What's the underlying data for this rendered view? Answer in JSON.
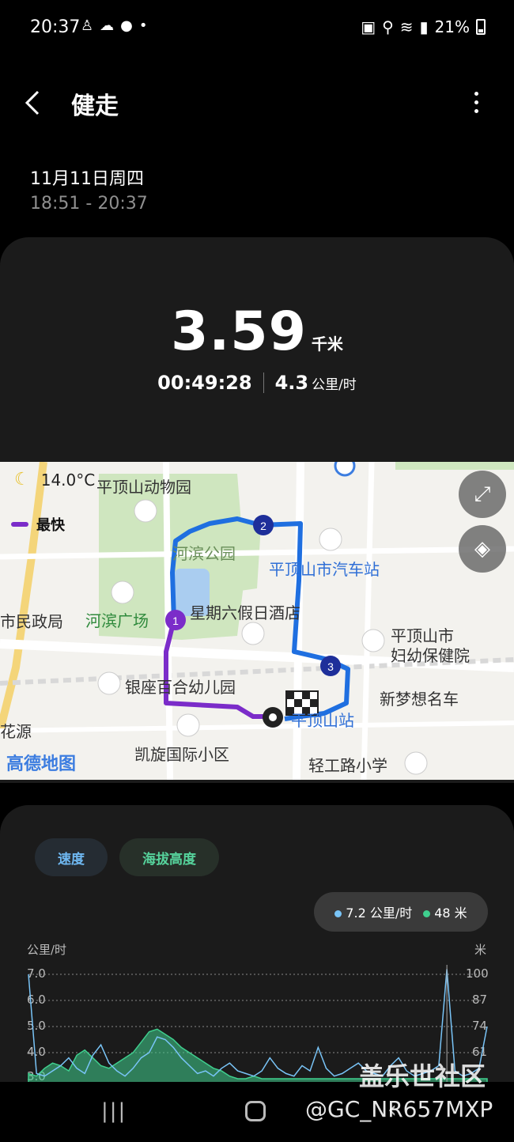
{
  "status": {
    "time": "20:37",
    "left_icons": [
      "person-icon",
      "weather-icon",
      "wechat-icon",
      "dot-icon"
    ],
    "right_icons": [
      "battery-saver-icon",
      "location-icon",
      "wifi-icon",
      "hd-icon",
      "signal-4g-icon"
    ],
    "battery": "21%"
  },
  "header": {
    "title": "健走"
  },
  "workout": {
    "date": "11月11日周四",
    "time_range": "18:51 - 20:37",
    "distance": "3.59",
    "distance_unit": "千米",
    "duration": "00:49:28",
    "speed": "4.3",
    "speed_unit": "公里/时"
  },
  "map": {
    "temperature": "14.0°C",
    "legend_fastest": "最快",
    "labels": {
      "zoo": "平顶山动物园",
      "hebin_park": "河滨公园",
      "bus_station": "平顶山市汽车站",
      "hebin_square": "河滨广场",
      "hotel": "星期六假日酒店",
      "gov": "市民政局",
      "hospital_1": "平顶山市",
      "hospital_2": "妇幼保健院",
      "kindergarten": "银座百合幼儿园",
      "car": "新梦想名车",
      "station": "平顶山站",
      "huayuan": "花源",
      "kaixuan": "凯旋国际小区",
      "school": "轻工路小学",
      "brand": "高德地图"
    },
    "markers": [
      "1",
      "2",
      "3"
    ]
  },
  "chart_tabs": {
    "speed": "速度",
    "altitude": "海拔高度"
  },
  "tooltip": {
    "speed": "7.2 公里/时",
    "altitude": "48 米"
  },
  "colors": {
    "speed": "#79c4f7",
    "altitude": "#3fcf8e",
    "route_blue": "#1f6fe0",
    "route_purple": "#7b2cc9"
  },
  "chart_data": {
    "type": "area",
    "left_axis_unit": "公里/时",
    "right_axis_unit": "米",
    "left_ticks": [
      "7.0",
      "6.0",
      "5.0",
      "4.0",
      "3.0"
    ],
    "right_ticks": [
      "100",
      "87",
      "74",
      "61"
    ],
    "series": [
      {
        "name": "速度",
        "values": [
          7.0,
          3.2,
          3.1,
          3.3,
          3.5,
          3.8,
          3.4,
          3.2,
          3.9,
          4.3,
          3.6,
          3.3,
          3.1,
          3.4,
          3.8,
          4.0,
          4.6,
          4.5,
          4.2,
          3.8,
          3.5,
          3.2,
          3.3,
          3.1,
          3.4,
          3.6,
          3.3,
          3.2,
          3.1,
          3.3,
          3.8,
          3.4,
          3.2,
          3.1,
          3.5,
          3.3,
          4.2,
          3.4,
          3.1,
          3.2,
          3.4,
          3.6,
          3.3,
          3.2,
          3.1,
          3.5,
          3.8,
          3.3,
          3.1,
          3.2,
          3.3,
          3.5,
          7.2,
          3.3,
          3.1,
          3.2,
          3.4,
          5.0
        ]
      },
      {
        "name": "海拔高度",
        "values": [
          3.2,
          3.1,
          3.4,
          3.6,
          3.5,
          3.3,
          3.9,
          4.1,
          3.8,
          3.5,
          3.4,
          3.6,
          3.8,
          4.0,
          4.4,
          4.8,
          4.9,
          4.7,
          4.5,
          4.2,
          4.0,
          3.8,
          3.6,
          3.4,
          3.3,
          3.1,
          3.0,
          3.0,
          3.1,
          3.0,
          3.0,
          3.0,
          3.0,
          3.0,
          3.0,
          3.0,
          3.0,
          3.0,
          3.0,
          3.0,
          3.0,
          3.0,
          3.0,
          3.0,
          3.0,
          3.0,
          3.0,
          3.0,
          3.0,
          3.0,
          3.0,
          3.0,
          3.0,
          3.0,
          3.0,
          3.0,
          3.0,
          3.0
        ]
      }
    ]
  },
  "watermark": {
    "line1": "盖乐世社区",
    "line2": "@GC_NR657MXP"
  }
}
